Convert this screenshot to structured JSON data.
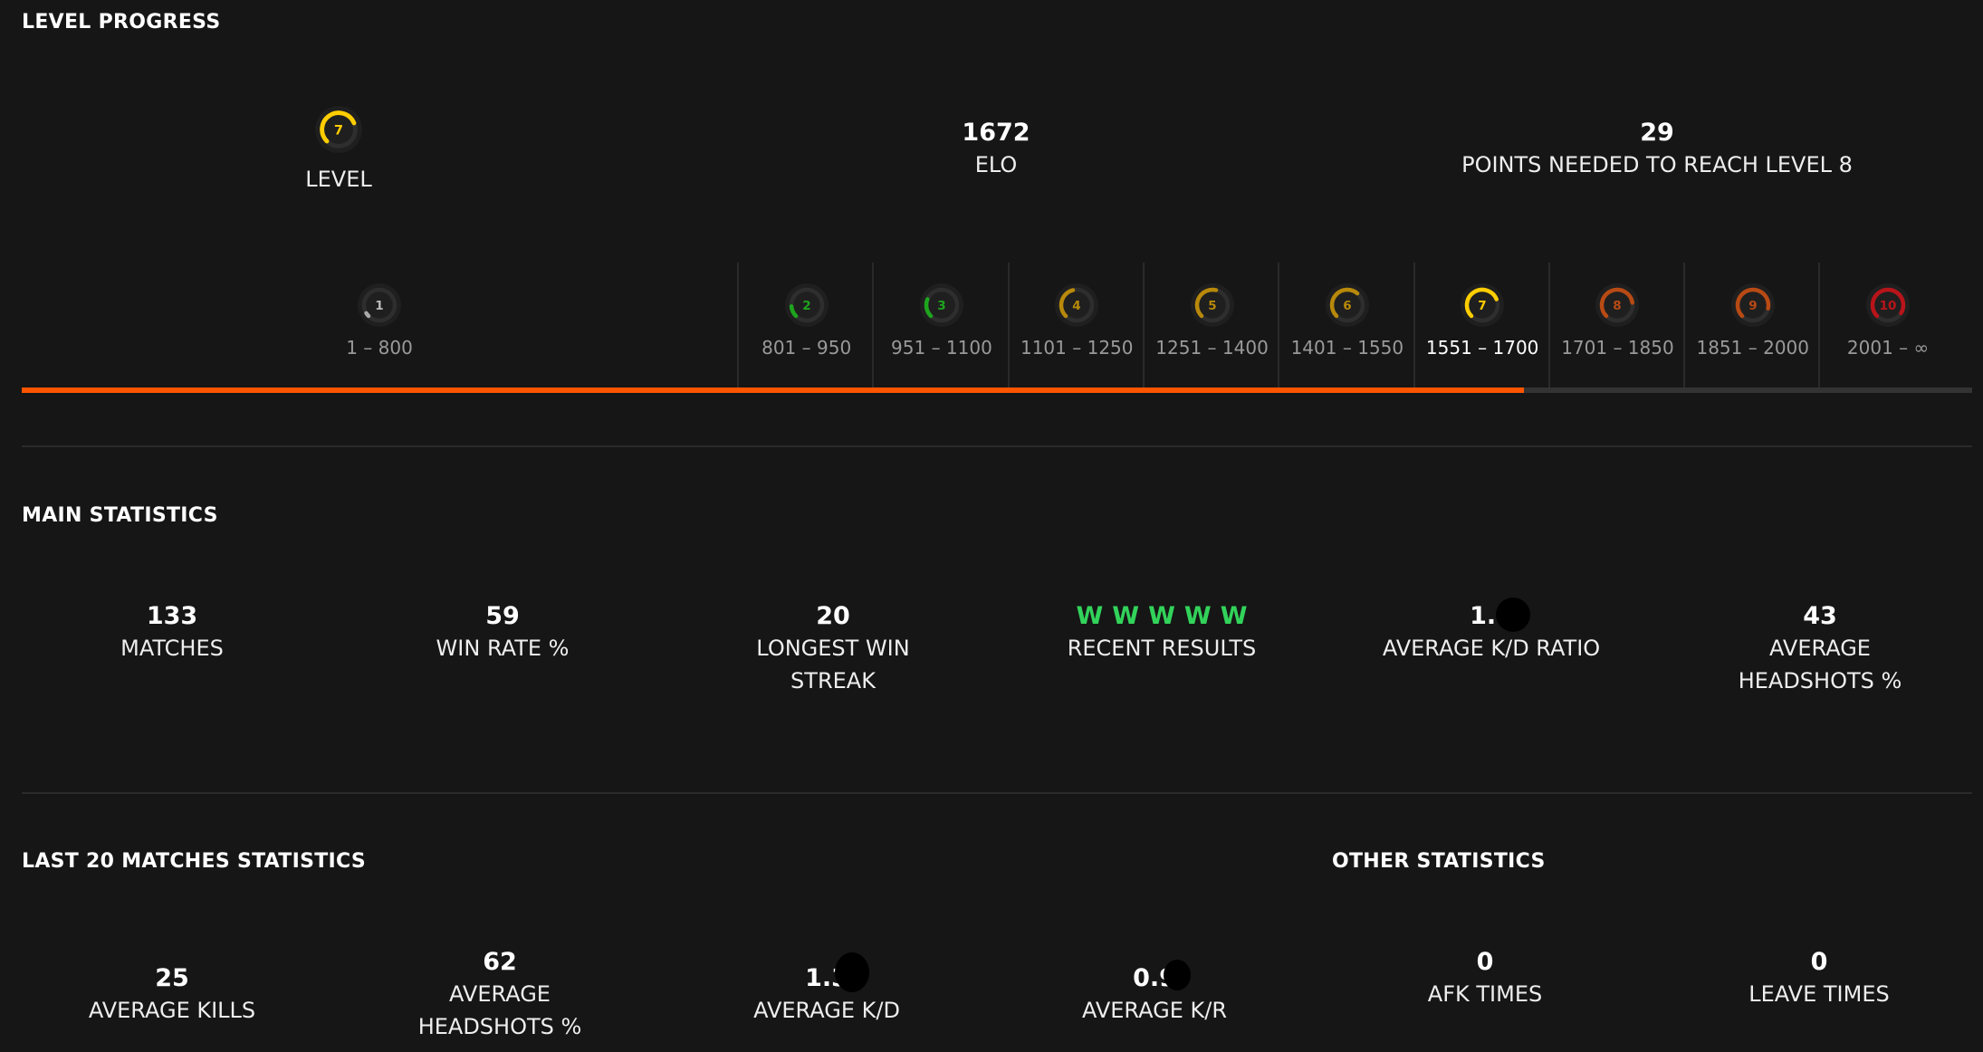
{
  "level_progress": {
    "title": "LEVEL PROGRESS",
    "current_level": {
      "value": "7",
      "label": "LEVEL",
      "color": "#ffcd00"
    },
    "elo": {
      "value": "1672",
      "label": "ELO"
    },
    "points_needed": {
      "value": "29",
      "label": "POINTS NEEDED TO REACH LEVEL 8"
    },
    "progress_fraction": 0.77,
    "levels": [
      {
        "level": "1",
        "range": "1 – 800",
        "color": "#aaaaaa",
        "fraction": 0.05
      },
      {
        "level": "2",
        "range": "801 – 950",
        "color": "#1ea51e",
        "fraction": 0.15
      },
      {
        "level": "3",
        "range": "951 – 1100",
        "color": "#1ea51e",
        "fraction": 0.25
      },
      {
        "level": "4",
        "range": "1101 – 1250",
        "color": "#b8890a",
        "fraction": 0.45
      },
      {
        "level": "5",
        "range": "1251 – 1400",
        "color": "#b8890a",
        "fraction": 0.55
      },
      {
        "level": "6",
        "range": "1401 – 1550",
        "color": "#b8890a",
        "fraction": 0.65
      },
      {
        "level": "7",
        "range": "1551 – 1700",
        "color": "#ffcd00",
        "fraction": 0.75
      },
      {
        "level": "8",
        "range": "1701 – 1850",
        "color": "#b84a14",
        "fraction": 0.8
      },
      {
        "level": "9",
        "range": "1851 – 2000",
        "color": "#b84a14",
        "fraction": 0.88
      },
      {
        "level": "10",
        "range": "2001 – ∞",
        "color": "#b8141a",
        "fraction": 0.95
      }
    ]
  },
  "main_statistics": {
    "title": "MAIN STATISTICS",
    "matches": {
      "value": "133",
      "label": "MATCHES"
    },
    "win_rate": {
      "value": "59",
      "label": "WIN RATE %"
    },
    "longest_streak": {
      "value": "20",
      "label_line1": "LONGEST WIN",
      "label_line2": "STREAK"
    },
    "recent_results": {
      "values": [
        "W",
        "W",
        "W",
        "W",
        "W"
      ],
      "label": "RECENT RESULTS",
      "color": "#32d35a"
    },
    "avg_kd_ratio": {
      "value": "1.1",
      "label": "AVERAGE K/D RATIO"
    },
    "avg_headshots": {
      "value": "43",
      "label_line1": "AVERAGE",
      "label_line2": "HEADSHOTS %"
    }
  },
  "last20": {
    "title": "LAST 20 MATCHES STATISTICS",
    "avg_kills": {
      "value": "25",
      "label": "AVERAGE KILLS"
    },
    "avg_headshots": {
      "value": "62",
      "label_line1": "AVERAGE",
      "label_line2": "HEADSHOTS %"
    },
    "avg_kd": {
      "value": "1.3",
      "label": "AVERAGE K/D"
    },
    "avg_kr": {
      "value": "0.9",
      "label": "AVERAGE K/R"
    }
  },
  "other": {
    "title": "OTHER STATISTICS",
    "afk": {
      "value": "0",
      "label": "AFK TIMES"
    },
    "leave": {
      "value": "0",
      "label": "LEAVE TIMES"
    }
  }
}
